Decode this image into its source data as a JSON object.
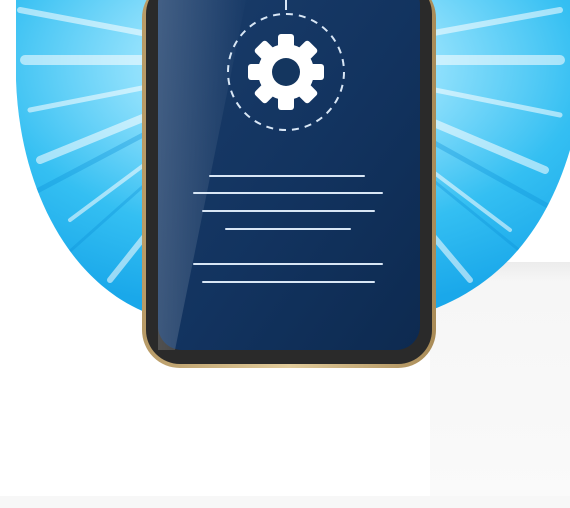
{
  "scene": {
    "icons": {
      "gear": "gear-icon",
      "phone": "smartphone-icon"
    },
    "colors": {
      "background": "#ffffff",
      "burst_light": "#cfeefc",
      "burst_mid": "#5fd0f8",
      "burst_dark": "#19a9ea",
      "phone_frame": "#2b2b2b",
      "phone_bezel_gold": "#c8ad7a",
      "screen_dark": "#0f2b52",
      "screen_light": "#2e5b8d",
      "line_color": "#d8e6f5",
      "gear_color": "#ffffff"
    },
    "screen_text_line_count": 6
  }
}
